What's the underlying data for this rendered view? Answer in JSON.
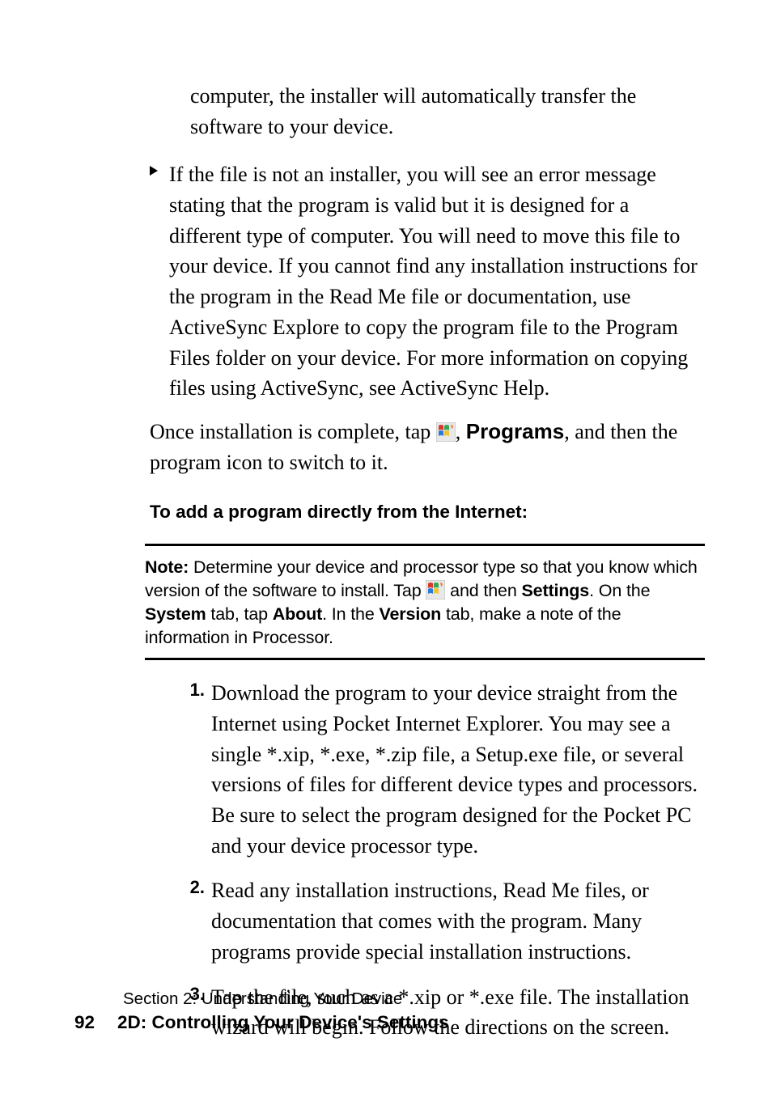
{
  "para_top": "computer, the installer will automatically transfer the software to your device.",
  "bullet_para": "If the file is not an installer, you will see an error message stating that the program is valid but it is designed for a different type of computer. You will need to move this file to your device. If you cannot find any installation instructions for the program in the Read Me file or documentation, use ActiveSync Explore to copy the program file to the Program Files folder on your device. For more information on copying files using ActiveSync, see ActiveSync Help.",
  "after_bullet_pre": "Once installation is complete, tap ",
  "after_bullet_mid": ", ",
  "after_bullet_bold": "Programs",
  "after_bullet_post": ", and then the program icon to switch to it.",
  "heading": "To add a program directly from the Internet:",
  "note_bold": "Note:",
  "note_1": " Determine your device and processor type so that you know which version of the software to install. Tap ",
  "note_2": " and then ",
  "note_settings": "Settings",
  "note_3": ". On the ",
  "note_system": "System",
  "note_4": " tab, tap ",
  "note_about": "About",
  "note_5": ". In the ",
  "note_version": "Version",
  "note_6": " tab, make a note of the information in Processor.",
  "ol": [
    {
      "n": "1.",
      "t": "Download the program to your device straight from the Internet using Pocket Internet Explorer. You may see a single *.xip, *.exe, *.zip file, a Setup.exe file, or several versions of files for different device types and processors. Be sure to select the program designed for the Pocket PC and your device processor type."
    },
    {
      "n": "2.",
      "t": "Read any installation instructions, Read Me files, or documentation that comes with the program. Many programs provide special installation instructions."
    },
    {
      "n": "3.",
      "t": "Tap the file, such as a *.xip or *.exe file. The installation wizard will begin. Follow the directions on the screen."
    }
  ],
  "footer_section": "Section 2: Understanding Your Device",
  "footer_page": "92",
  "footer_title": "2D: Controlling Your Device's Settings"
}
